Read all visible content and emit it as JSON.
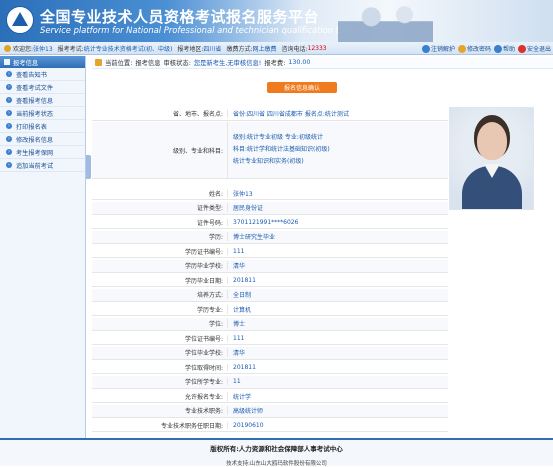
{
  "header": {
    "title": "全国专业技术人员资格考试报名服务平台",
    "subtitle": "Service platform for National Professional and technician qualification test"
  },
  "infobar": {
    "welcome_label": "欢迎您:",
    "welcome_value": "张仲13",
    "exam_label": "报考考试:",
    "exam_value": "统计专业技术资格考试(初、中级)",
    "region_label": "报考地区:",
    "region_value": "四川省",
    "mode_label": "缴费方式:",
    "mode_value": "网上缴费",
    "phone_label": "咨询电话:",
    "phone_value": "12333",
    "tools": [
      {
        "label": "注销解护",
        "icon": "user-icon",
        "color": "#3a7fcf"
      },
      {
        "label": "修改密码",
        "icon": "lock-icon",
        "color": "#e5a42c"
      },
      {
        "label": "帮助",
        "icon": "help-icon",
        "color": "#3a7fcf"
      },
      {
        "label": "安全退出",
        "icon": "power-icon",
        "color": "#d9342b"
      }
    ]
  },
  "sidebar": {
    "header": "报考信息",
    "items": [
      {
        "label": "查看告知书"
      },
      {
        "label": "查看考试文件"
      },
      {
        "label": "查看报考信息"
      },
      {
        "label": "当前报考状态"
      },
      {
        "label": "打印报名表"
      },
      {
        "label": "修改报名信息"
      },
      {
        "label": "考生报考保网"
      },
      {
        "label": "追加当前考试"
      }
    ]
  },
  "breadcrumb": {
    "location_label": "当前位置:",
    "location_value": "报考信息",
    "status_label": "审核状态:",
    "status_value": "您是新考生,无审核信息!",
    "fee_label": "报考费:",
    "fee_value": "130.00"
  },
  "main": {
    "confirm_button": "报名信息确认",
    "region_label": "省、地市、报名点:",
    "region_value": "省份:四川省   四川省成都市   报名点:统计测试",
    "subject_label": "级别、专业和科目:",
    "subject_lines": [
      "级别:统计专业初级   专业:初级统计",
      "科目:统计学和统计法基础知识(初级)",
      "      统计专业知识和实务(初级)"
    ],
    "fields": [
      {
        "label": "姓名:",
        "value": "张仲13"
      },
      {
        "label": "证件类型:",
        "value": "居民身份证"
      },
      {
        "label": "证件号码:",
        "value": "3701121991****6026"
      },
      {
        "label": "学历:",
        "value": "博士研究生毕业"
      },
      {
        "label": "学历证书编号:",
        "value": "111"
      },
      {
        "label": "学历毕业学校:",
        "value": "清华"
      },
      {
        "label": "学历毕业日期:",
        "value": "201811"
      },
      {
        "label": "培养方式:",
        "value": "全日制"
      },
      {
        "label": "学历专业:",
        "value": "计算机"
      },
      {
        "label": "学位:",
        "value": "博士"
      },
      {
        "label": "学位证书编号:",
        "value": "111"
      },
      {
        "label": "学位毕业学校:",
        "value": "清华"
      },
      {
        "label": "学位取得时间:",
        "value": "201811"
      },
      {
        "label": "学位所学专业:",
        "value": "11"
      },
      {
        "label": "允许报名专业:",
        "value": "统计学"
      },
      {
        "label": "专业技术职务:",
        "value": "高级统计师"
      },
      {
        "label": "专业技术职务任职日期:",
        "value": "20190610"
      }
    ]
  },
  "footer": {
    "copyright": "版权所有:人力资源和社会保障部人事考试中心",
    "support": "技术支持:山东山大鸥玛软件股份有限公司"
  }
}
